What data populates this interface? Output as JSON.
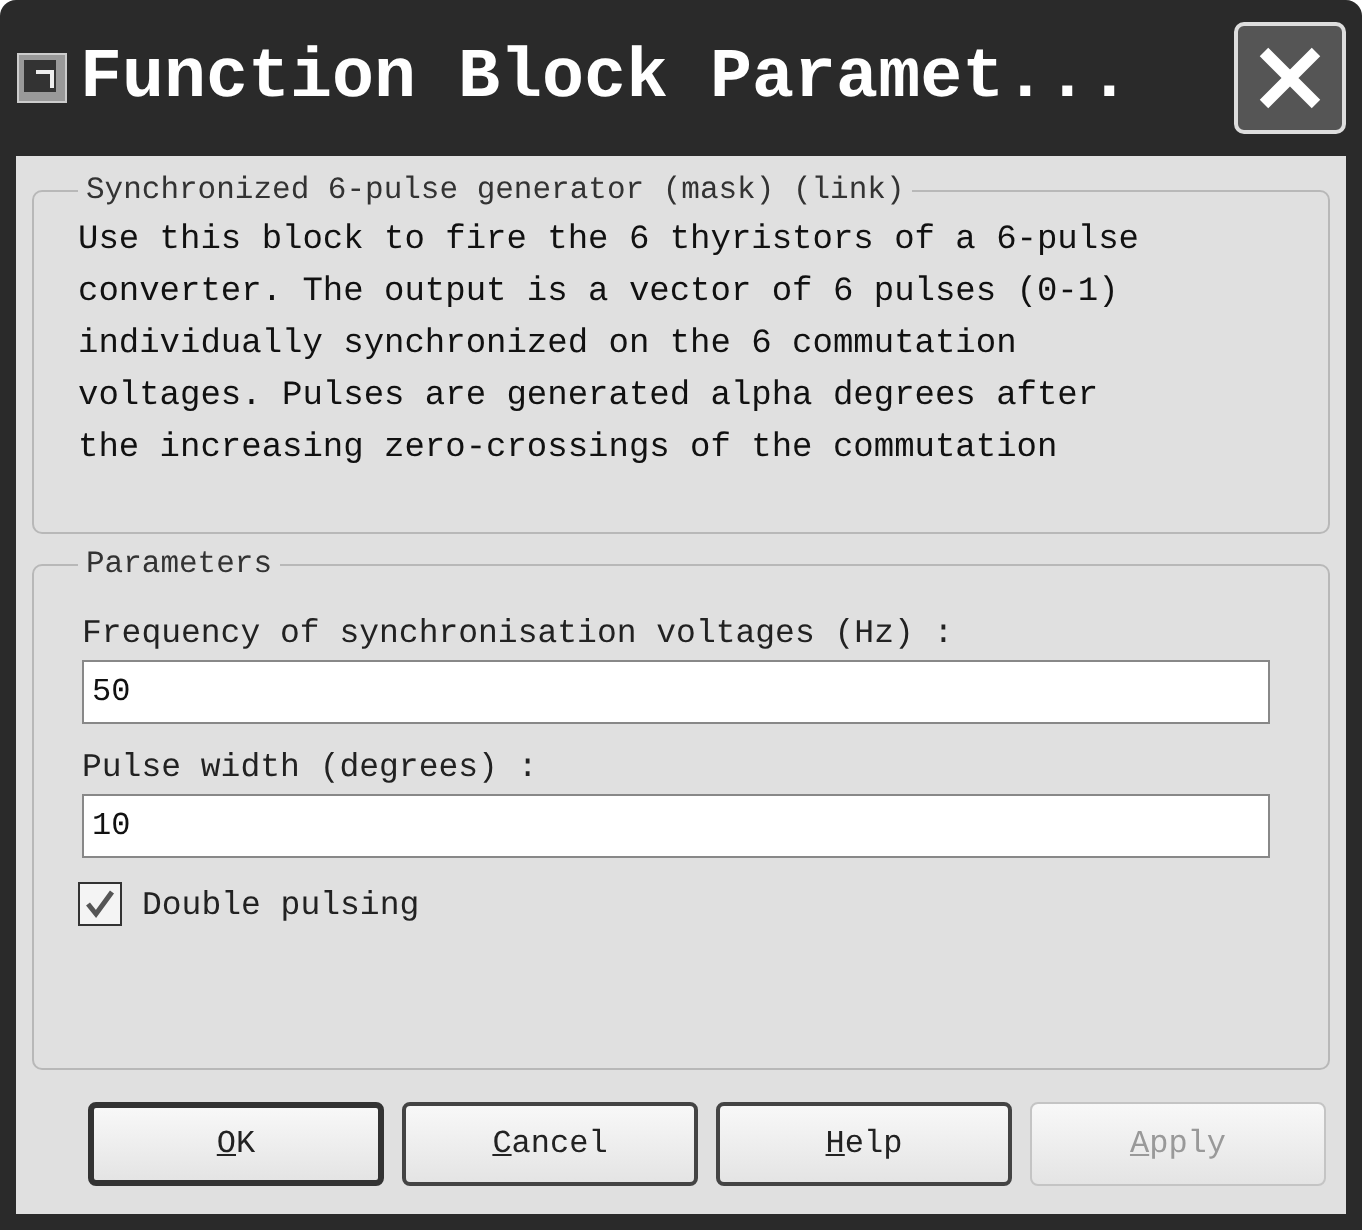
{
  "window": {
    "title": "Function Block Paramet..."
  },
  "description": {
    "legend": "Synchronized 6-pulse generator (mask) (link)",
    "lines": [
      "Use this block to fire the 6 thyristors of a 6-pulse",
      "converter. The output is a vector of 6 pulses (0-1)",
      "individually synchronized on the 6 commutation",
      "voltages. Pulses are generated alpha degrees after",
      "the increasing zero-crossings of the commutation"
    ]
  },
  "parameters": {
    "legend": "Parameters",
    "fields": [
      {
        "label": "Frequency of synchronisation voltages (Hz) :",
        "value": "50"
      },
      {
        "label": "Pulse width (degrees) :",
        "value": "10"
      }
    ],
    "checkbox": {
      "label": "Double pulsing",
      "checked": true
    }
  },
  "buttons": [
    {
      "label": "OK",
      "default": true,
      "disabled": false
    },
    {
      "label": "Cancel",
      "default": false,
      "disabled": false
    },
    {
      "label": "Help",
      "default": false,
      "disabled": false
    },
    {
      "label": "Apply",
      "default": false,
      "disabled": true
    }
  ]
}
